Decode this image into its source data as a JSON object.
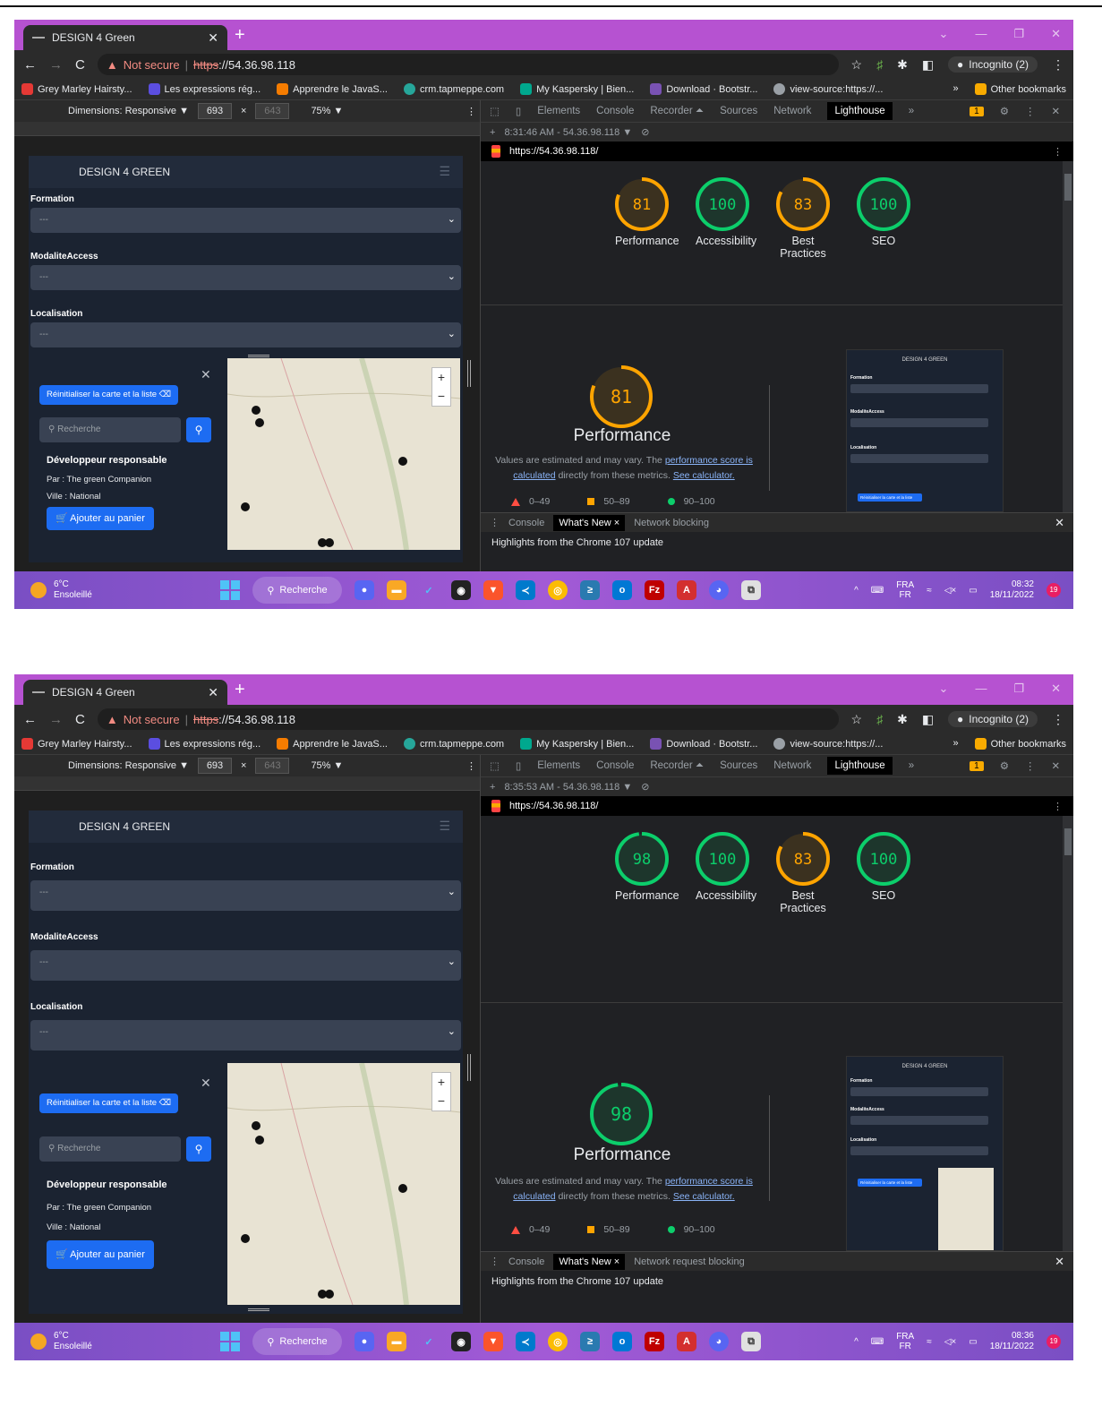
{
  "screenshots": [
    {
      "tab_title": "DESIGN 4 Green",
      "url_warning": "Not secure",
      "url_scheme": "https",
      "url_host": "://54.36.98.118",
      "incognito_label": "Incognito (2)",
      "bookmarks": [
        "Grey Marley Hairsty...",
        "Les expressions rég...",
        "Apprendre le JavaS...",
        "crm.tapmeppe.com",
        "My Kaspersky | Bien...",
        "Download · Bootstr...",
        "view-source:https://..."
      ],
      "other_bookmarks": "Other bookmarks",
      "dimensions_label": "Dimensions: Responsive ▼",
      "width_value": "693",
      "height_value": "643",
      "zoom": "75% ▼",
      "devtools_tabs": [
        "Elements",
        "Console",
        "Recorder ⏶",
        "Sources",
        "Network",
        "Lighthouse"
      ],
      "issues_badge": "1",
      "report_time": "8:31:46 AM - 54.36.98.118 ▼",
      "report_url": "https://54.36.98.118/",
      "scores": [
        {
          "label": "Performance",
          "value": 81,
          "color": "#ffa400"
        },
        {
          "label": "Accessibility",
          "value": 100,
          "color": "#0cce6b"
        },
        {
          "label": "Best Practices",
          "value": 83,
          "color": "#ffa400"
        },
        {
          "label": "SEO",
          "value": 100,
          "color": "#0cce6b"
        }
      ],
      "perf_title": "Performance",
      "drawer_tabs": [
        "Console",
        "What's New",
        "Network blocking"
      ],
      "drawer_text": "Highlights from the Chrome 107 update",
      "time": "08:32",
      "date": "18/11/2022"
    },
    {
      "tab_title": "DESIGN 4 Green",
      "url_warning": "Not secure",
      "url_scheme": "https",
      "url_host": "://54.36.98.118",
      "incognito_label": "Incognito (2)",
      "bookmarks": [
        "Grey Marley Hairsty...",
        "Les expressions rég...",
        "Apprendre le JavaS...",
        "crm.tapmeppe.com",
        "My Kaspersky | Bien...",
        "Download · Bootstr...",
        "view-source:https://..."
      ],
      "other_bookmarks": "Other bookmarks",
      "dimensions_label": "Dimensions: Responsive ▼",
      "width_value": "693",
      "height_value": "643",
      "zoom": "75% ▼",
      "devtools_tabs": [
        "Elements",
        "Console",
        "Recorder ⏶",
        "Sources",
        "Network",
        "Lighthouse"
      ],
      "issues_badge": "1",
      "report_time": "8:35:53 AM - 54.36.98.118 ▼",
      "report_url": "https://54.36.98.118/",
      "scores": [
        {
          "label": "Performance",
          "value": 98,
          "color": "#0cce6b"
        },
        {
          "label": "Accessibility",
          "value": 100,
          "color": "#0cce6b"
        },
        {
          "label": "Best Practices",
          "value": 83,
          "color": "#ffa400"
        },
        {
          "label": "SEO",
          "value": 100,
          "color": "#0cce6b"
        }
      ],
      "perf_title": "Performance",
      "drawer_tabs": [
        "Console",
        "What's New",
        "Network request blocking"
      ],
      "drawer_text": "Highlights from the Chrome 107 update",
      "time": "08:36",
      "date": "18/11/2022"
    }
  ],
  "site": {
    "brand": "DESIGN 4 GREEN",
    "formation_label": "Formation",
    "modalite_label": "ModaliteAccess",
    "localisation_label": "Localisation",
    "select_placeholder": "---",
    "reset_button": "Réinitialiser la carte et la liste",
    "search_placeholder": "Recherche",
    "course_title": "Développeur responsable",
    "course_by": "Par : The green Companion",
    "course_city": "Ville : National",
    "cart_button": "Ajouter au panier"
  },
  "lighthouse_note": {
    "prefix": "Values are estimated and may vary. The ",
    "link1": "performance score is calculated",
    "middle": " directly from these metrics. ",
    "link2": "See calculator."
  },
  "legend": [
    "0–49",
    "50–89",
    "90–100"
  ],
  "weather": {
    "temp": "6°C",
    "desc": "Ensoleillé"
  },
  "taskbar_search": "Recherche",
  "lang": {
    "top": "FRA",
    "bottom": "FR"
  },
  "notif_count": "19",
  "colors": {
    "chrome_frame": "#b652d1",
    "accent_blue": "#1d6cf2",
    "pass": "#0cce6b",
    "average": "#ffa400",
    "fail": "#ff4e42"
  }
}
